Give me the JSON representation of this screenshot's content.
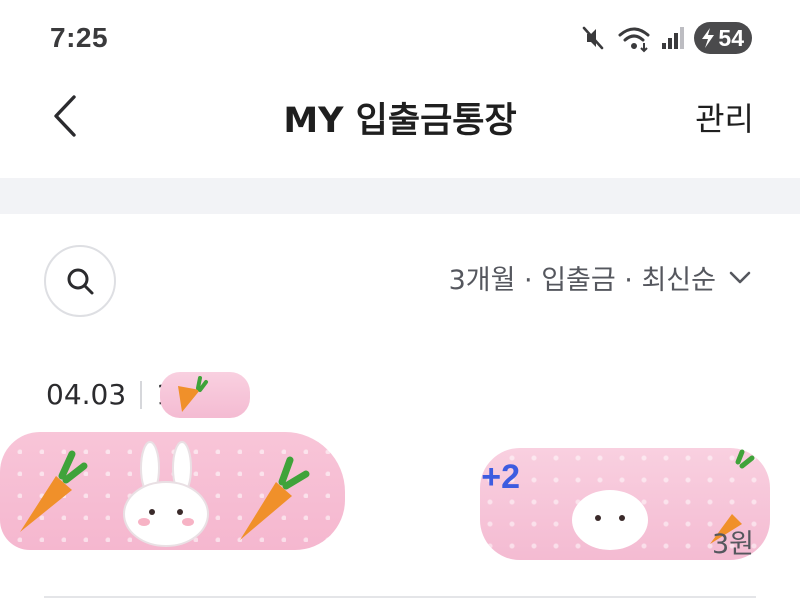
{
  "status_bar": {
    "time": "7:25",
    "battery_level": "54"
  },
  "nav": {
    "title": "MY 입출금통장",
    "manage_label": "관리"
  },
  "filter": {
    "label": "3개월 · 입출금 · 최신순"
  },
  "transaction": {
    "date": "04.03",
    "time_partial": "1",
    "amount_partial": "+2",
    "balance_suffix": "3원"
  },
  "colors": {
    "accent_blue": "#3d5ce0",
    "divider_band": "#f2f3f6",
    "redaction_pink": "#f5b7cf"
  },
  "icons": [
    "mute-icon",
    "wifi-icon",
    "signal-icon",
    "battery-icon",
    "back-chevron-icon",
    "search-icon",
    "chevron-down-icon",
    "bunny-sticker",
    "carrot-sticker"
  ]
}
